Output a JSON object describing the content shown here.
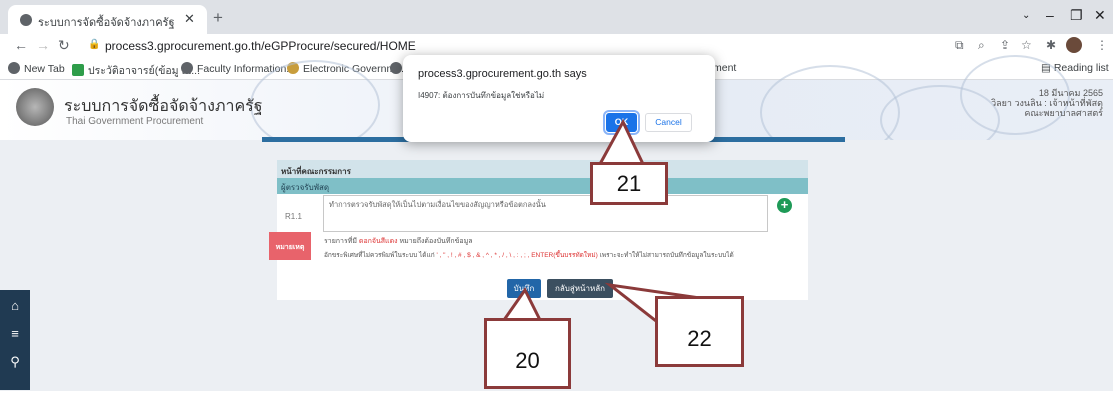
{
  "browser": {
    "tab_title": "ระบบการจัดซื้อจัดจ้างภาครัฐ",
    "url": "process3.gprocurement.go.th/eGPProcure/secured/HOME",
    "bookmarks": [
      "New Tab",
      "ประวัติอาจารย์(ข้อมู ณ...",
      "Faculty Information...",
      "Electronic Governm...",
      "ment"
    ],
    "reading_list": "Reading list"
  },
  "site": {
    "title": "ระบบการจัดซื้อจัดจ้างภาครัฐ",
    "subtitle": "Thai Government Procurement",
    "date_line1": "18 มีนาคม 2565",
    "date_line2": "วิลยา วงนลิน : เจ้าหน้าที่พัสดุ",
    "date_line3": "คณะพยาบาลศาสตร์"
  },
  "form": {
    "header": "หน้าที่คณะกรรมการ",
    "subheader": "ผู้ตรวจรับพัสดุ",
    "row_label": "R1.1",
    "textarea_text": "ทำการตรวจรับพัสดุให้เป็นไปตามเงื่อนไขของสัญญาหรือข้อตกลงนั้น",
    "remark_label": "หมายเหตุ",
    "note1_a": "รายการที่มี",
    "note1_red": "ดอกจันสีแดง",
    "note1_b": "หมายถึงต้องบันทึกข้อมูล",
    "note2_a": "อักขระพิเศษที่ไม่ควรพิมพ์ในระบบ ได้แก่",
    "note2_red": "' , \" , ! , # , $ , & , ^ , * , / , \\ , : , ; , ENTER(ขึ้นบรรทัดใหม่)",
    "note2_b": "เพราะจะทำให้ไม่สามารถบันทึกข้อมูลในระบบได้",
    "save_label": "บันทึก",
    "back_label": "กลับสู่หน้าหลัก"
  },
  "dialog": {
    "title": "process3.gprocurement.go.th says",
    "message": "I4907: ต้องการบันทึกข้อมูลใช่หรือไม่",
    "ok_label": "OK",
    "cancel_label": "Cancel"
  },
  "callouts": {
    "c20": "20",
    "c21": "21",
    "c22": "22"
  },
  "fab_icons": [
    "home-icon",
    "menu-icon",
    "search-icon"
  ],
  "colors": {
    "ok_blue": "#1a73e8",
    "callout_border": "#8b3a3a",
    "save_blue": "#2266a8",
    "remark_red": "#e8636b"
  }
}
